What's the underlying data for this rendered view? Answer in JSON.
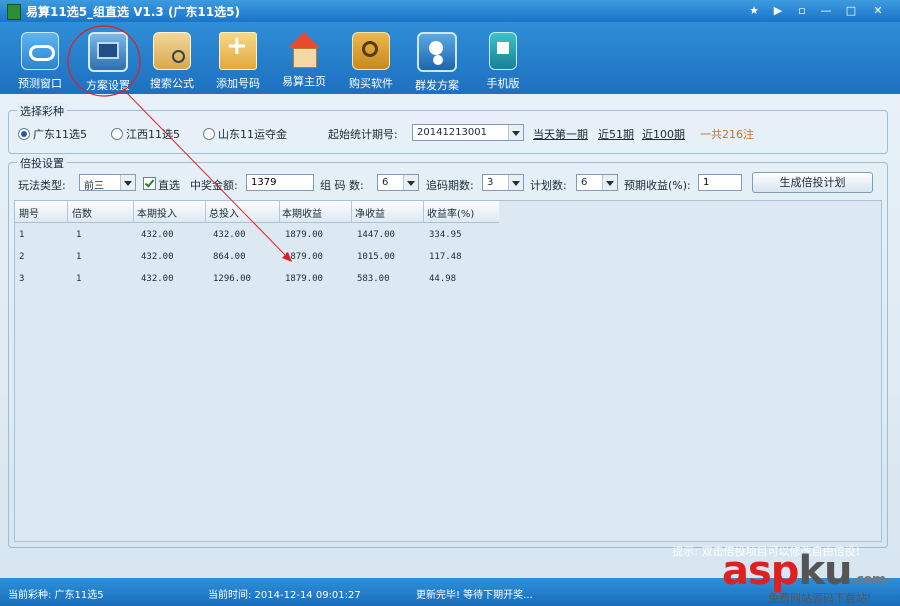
{
  "window": {
    "title": "易算11选5_组直选 V1.3 (广东11选5)",
    "buttons": [
      "★",
      "▶",
      "▫",
      "—",
      "□",
      "✕"
    ]
  },
  "toolbar": {
    "items": [
      {
        "label": "预测窗口",
        "icon": "cloud-icon"
      },
      {
        "label": "方案设置",
        "icon": "monitor-icon"
      },
      {
        "label": "搜索公式",
        "icon": "clipboard-search-icon"
      },
      {
        "label": "添加号码",
        "icon": "folder-add-icon"
      },
      {
        "label": "易算主页",
        "icon": "house-icon"
      },
      {
        "label": "购买软件",
        "icon": "key-icon"
      },
      {
        "label": "群发方案",
        "icon": "users-icon"
      },
      {
        "label": "手机版",
        "icon": "phone-icon"
      }
    ]
  },
  "lottery_group": {
    "legend": "选择彩种",
    "options": [
      {
        "label": "广东11选5",
        "selected": true
      },
      {
        "label": "江西11选5",
        "selected": false
      },
      {
        "label": "山东11运夺金",
        "selected": false
      }
    ],
    "start_period_label": "起始统计期号:",
    "start_period_value": "20141213001",
    "links": [
      "当天第一期",
      "近51期",
      "近100期"
    ],
    "total_text": "一共216注"
  },
  "plan_group": {
    "legend": "倍投设置",
    "play_type_label": "玩法类型:",
    "play_type_value": "前三",
    "direct_label": "直选",
    "prize_label": "中奖金额:",
    "prize_value": "1379",
    "group_count_label": "组 码 数:",
    "group_count_value": "6",
    "chase_label": "追码期数:",
    "chase_value": "3",
    "plan_count_label": "计划数:",
    "plan_count_value": "6",
    "profit_label": "预期收益(%):",
    "profit_value": "1",
    "generate_button": "生成倍投计划"
  },
  "table": {
    "columns": [
      "期号",
      "倍数",
      "本期投入",
      "总投入",
      "本期收益",
      "净收益",
      "收益率(%)"
    ],
    "rows": [
      [
        "1",
        "1",
        "432.00",
        "432.00",
        "1879.00",
        "1447.00",
        "334.95"
      ],
      [
        "2",
        "1",
        "432.00",
        "864.00",
        "1879.00",
        "1015.00",
        "117.48"
      ],
      [
        "3",
        "1",
        "432.00",
        "1296.00",
        "1879.00",
        "583.00",
        "44.98"
      ]
    ]
  },
  "hint": "提示: 双击倍投项目可以修改自由倍投!",
  "status": {
    "lottery": "当前彩种: 广东11选5",
    "time": "当前时间: 2014-12-14 09:01:27",
    "message": "更新完毕! 等待下期开奖..."
  },
  "watermark": {
    "brand_a": "asp",
    "brand_b": "ku",
    "suffix": ".com",
    "sub": "免费网站源码下载站!"
  },
  "colors": {
    "titlebar": "#1a74c8",
    "annotation_red": "#e02020",
    "link_orange": "#d0701a"
  }
}
